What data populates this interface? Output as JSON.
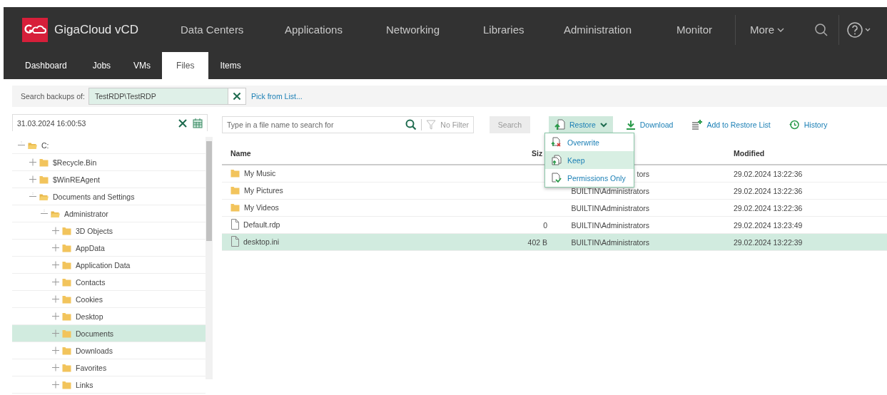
{
  "brand": {
    "title": "GigaCloud vCD"
  },
  "nav": [
    {
      "label": "Data Centers"
    },
    {
      "label": "Applications"
    },
    {
      "label": "Networking"
    },
    {
      "label": "Libraries"
    },
    {
      "label": "Administration"
    },
    {
      "label": "Monitor"
    }
  ],
  "more": {
    "label": "More"
  },
  "subtabs": [
    {
      "label": "Dashboard",
      "selected": false
    },
    {
      "label": "Jobs",
      "selected": false
    },
    {
      "label": "VMs",
      "selected": false
    },
    {
      "label": "Files",
      "selected": true
    },
    {
      "label": "Items",
      "selected": false
    }
  ],
  "backup_search": {
    "label": "Search backups of:",
    "value": "TestRDP\\TestRDP",
    "link": "Pick from List..."
  },
  "restore_point": {
    "value": "31.03.2024 16:00:53"
  },
  "tree": [
    {
      "label": "C:",
      "expanded": true,
      "selected": false,
      "children": [
        {
          "label": "$Recycle.Bin",
          "expanded": false,
          "selected": false
        },
        {
          "label": "$WinREAgent",
          "expanded": false,
          "selected": false
        },
        {
          "label": "Documents and Settings",
          "expanded": true,
          "selected": false,
          "children": [
            {
              "label": "Administrator",
              "expanded": true,
              "selected": false,
              "children": [
                {
                  "label": "3D Objects",
                  "expanded": false,
                  "selected": false
                },
                {
                  "label": "AppData",
                  "expanded": false,
                  "selected": false
                },
                {
                  "label": "Application Data",
                  "expanded": false,
                  "selected": false
                },
                {
                  "label": "Contacts",
                  "expanded": false,
                  "selected": false
                },
                {
                  "label": "Cookies",
                  "expanded": false,
                  "selected": false
                },
                {
                  "label": "Desktop",
                  "expanded": false,
                  "selected": false
                },
                {
                  "label": "Documents",
                  "expanded": false,
                  "selected": true
                },
                {
                  "label": "Downloads",
                  "expanded": false,
                  "selected": false
                },
                {
                  "label": "Favorites",
                  "expanded": false,
                  "selected": false
                },
                {
                  "label": "Links",
                  "expanded": false,
                  "selected": false
                }
              ]
            }
          ]
        }
      ]
    }
  ],
  "file_search": {
    "placeholder": "Type in a file name to search for",
    "filter": "No Filter",
    "button": "Search"
  },
  "toolbar": [
    {
      "kind": "restore",
      "label": "Restore"
    },
    {
      "kind": "download",
      "label": "Download"
    },
    {
      "kind": "add",
      "label": "Add to Restore List"
    },
    {
      "kind": "history",
      "label": "History"
    }
  ],
  "restore_menu": [
    {
      "kind": "overwrite",
      "label": "Overwrite",
      "highlighted": false
    },
    {
      "kind": "keep",
      "label": "Keep",
      "highlighted": true
    },
    {
      "kind": "permissions",
      "label": "Permissions Only",
      "highlighted": false
    }
  ],
  "table": {
    "columns": [
      {
        "label": "Name"
      },
      {
        "label": "Siz"
      },
      {},
      {
        "label": "Modified"
      }
    ],
    "rows": [
      {
        "kind": "folder",
        "name": "My Music",
        "size": "",
        "owner": "tors",
        "modified": "29.02.2024 13:22:36",
        "selected": false
      },
      {
        "kind": "folder",
        "name": "My Pictures",
        "size": "",
        "owner": "BUILTIN\\Administrators",
        "modified": "29.02.2024 13:22:36",
        "selected": false
      },
      {
        "kind": "folder",
        "name": "My Videos",
        "size": "",
        "owner": "BUILTIN\\Administrators",
        "modified": "29.02.2024 13:22:36",
        "selected": false
      },
      {
        "kind": "file",
        "name": "Default.rdp",
        "size": "0",
        "owner": "BUILTIN\\Administrators",
        "modified": "29.02.2024 13:23:49",
        "selected": false
      },
      {
        "kind": "file",
        "name": "desktop.ini",
        "size": "402 B",
        "owner": "BUILTIN\\Administrators",
        "modified": "29.02.2024 13:22:39",
        "selected": true
      }
    ]
  }
}
